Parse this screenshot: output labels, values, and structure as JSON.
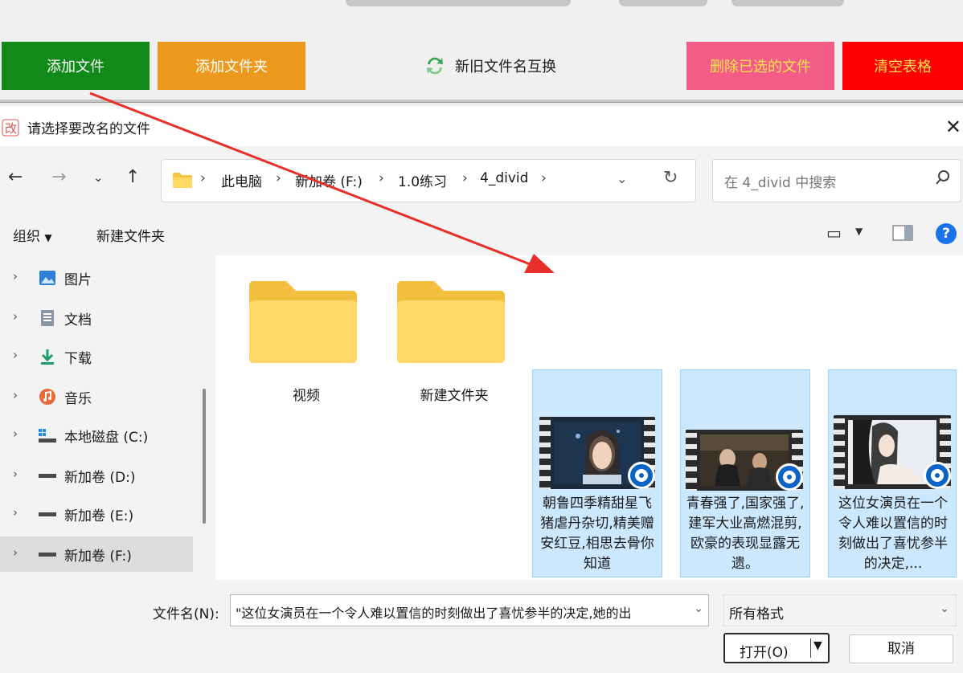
{
  "app_toolbar": {
    "add_file": "添加文件",
    "add_folder": "添加文件夹",
    "swap_names": "新旧文件名互换",
    "delete_selected": "删除已选的文件",
    "clear_table": "清空表格"
  },
  "dialog": {
    "title": "请选择要改名的文件",
    "breadcrumb": [
      "此电脑",
      "新加卷 (F:)",
      "1.0练习",
      "4_divid"
    ],
    "search_placeholder": "在 4_divid 中搜索",
    "commands": {
      "organize": "组织",
      "new_folder": "新建文件夹"
    },
    "sidebar": [
      {
        "label": "图片",
        "icon": "pictures-icon"
      },
      {
        "label": "文档",
        "icon": "documents-icon"
      },
      {
        "label": "下载",
        "icon": "download-icon"
      },
      {
        "label": "音乐",
        "icon": "music-icon"
      },
      {
        "label": "本地磁盘 (C:)",
        "icon": "local-disk-icon"
      },
      {
        "label": "新加卷 (D:)",
        "icon": "drive-icon"
      },
      {
        "label": "新加卷 (E:)",
        "icon": "drive-icon"
      },
      {
        "label": "新加卷 (F:)",
        "icon": "drive-icon",
        "selected": true
      }
    ],
    "folders": [
      "视频",
      "新建文件夹"
    ],
    "videos": [
      {
        "name": "朝鲁四季精甜星飞猪虐丹杂切,精美赠安红豆,相思去骨你知道",
        "selected": true
      },
      {
        "name": "青春强了,国家强了,建军大业高燃混剪,欧豪的表现显露无遗。",
        "selected": true
      },
      {
        "name": "这位女演员在一个令人难以置信的时刻做出了喜忧参半的决定,...",
        "selected": true
      }
    ],
    "filename_label": "文件名(N):",
    "filename_value": "\"这位女演员在一个令人难以置信的时刻做出了喜忧参半的决定,她的出",
    "filter_value": "所有格式",
    "open_label": "打开(O)",
    "cancel_label": "取消"
  },
  "colors": {
    "add_file": "#128a1a",
    "add_folder": "#ec9a1e",
    "delete_selected": "#f25c86",
    "clear_table": "#ff0000",
    "selection": "#cce8ff",
    "annotation_arrow": "#e8302a"
  }
}
